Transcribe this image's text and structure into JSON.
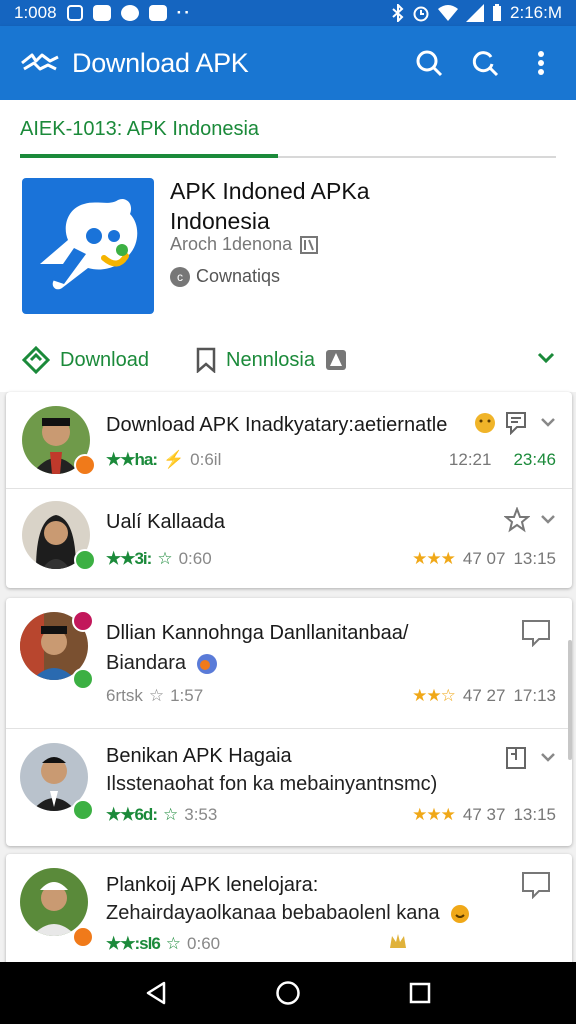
{
  "status_bar": {
    "time_left": "1:008",
    "time_right": "2:16:M",
    "dots": "··"
  },
  "app_bar": {
    "title": "Download APK"
  },
  "tab": {
    "label": "AIEK-1013: APK Indonesia"
  },
  "app": {
    "name_line1": "APK Indoned APKa",
    "name_line2": "Indonesia",
    "subtitle": "Aroch 1denona",
    "developer": "Cownatiqs"
  },
  "actions": {
    "download_label": "Download",
    "bookmark_label": "Nennlosia"
  },
  "items": [
    {
      "title": "Download APK Inadkyatary:aetiernatle",
      "rating_left": "★★ha:",
      "meta_left": "0:6il",
      "meta_right_a": "12:21",
      "meta_right_b": "23:46"
    },
    {
      "title": "Ualí Kallaada",
      "rating_left": "★★3i:",
      "meta_left": "0:60",
      "meta_right_a": "47 07",
      "meta_right_b": "13:15"
    },
    {
      "title": "Dllian Kannohnga Danllanitanbaa/",
      "subtitle": "Biandara",
      "rating_left": "6rtsk",
      "meta_left": "1:57",
      "meta_right_a": "47 27",
      "meta_right_b": "17:13"
    },
    {
      "title": "Benikan APK Hagaia",
      "subtitle": "Ilsstenaohat fon ka mebainyantnsmc)",
      "rating_left": "★★6d:",
      "meta_left": "3:53",
      "meta_right_a": "47 37",
      "meta_right_b": "13:15"
    },
    {
      "title": "Plankoij APK lenelojara:",
      "subtitle": "Zehairdayaolkanaa bebabaolenl kana",
      "rating_left": "★★:sl6",
      "meta_left": "0:60"
    }
  ],
  "colors": {
    "primary": "#1976d2",
    "status": "#1565c0",
    "green": "#1b8a3a",
    "gold": "#f0a818"
  }
}
